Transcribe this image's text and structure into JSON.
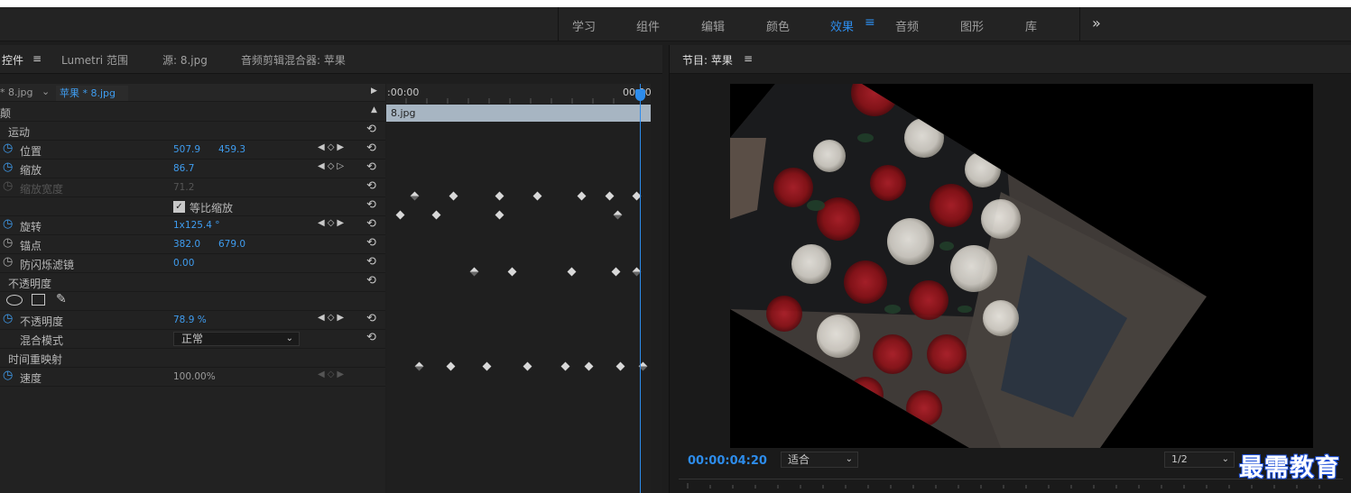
{
  "workspaces": {
    "items": [
      "学习",
      "组件",
      "编辑",
      "颜色",
      "效果",
      "音频",
      "图形",
      "库"
    ],
    "active": "效果",
    "more": "»"
  },
  "effect_controls": {
    "tabs": {
      "effect_controls": "控件",
      "lumetri": "Lumetri 范围",
      "source": "源: 8.jpg",
      "mixer": "音频剪辑混合器: 苹果"
    },
    "menu_glyph": "≡",
    "clip": {
      "source": "* 8.jpg",
      "sequence": "苹果 * 8.jpg"
    },
    "video_label": "颠",
    "motion": "运动",
    "position": {
      "label": "位置",
      "x": "507.9",
      "y": "459.3"
    },
    "scale": {
      "label": "缩放",
      "value": "86.7"
    },
    "scale_width": {
      "label": "缩放宽度",
      "value": "71.2"
    },
    "uniform_scale": "等比缩放",
    "rotation": {
      "label": "旋转",
      "value": "1x125.4 °"
    },
    "anchor": {
      "label": "锚点",
      "x": "382.0",
      "y": "679.0"
    },
    "antiflicker": {
      "label": "防闪烁滤镜",
      "value": "0.00"
    },
    "opacity_group": "不透明度",
    "opacity": {
      "label": "不透明度",
      "value": "78.9 %"
    },
    "blend": {
      "label": "混合模式",
      "value": "正常"
    },
    "time_remap": "时间重映射",
    "speed": {
      "label": "速度",
      "value": "100.00%"
    }
  },
  "timeline": {
    "start": ":00:00",
    "end": "00:00",
    "clip_name": "8.jpg"
  },
  "program": {
    "title": "节目: 苹果",
    "menu_glyph": "≡",
    "timecode": "00:00:04:20",
    "fit": "适合",
    "resolution": "1/2"
  },
  "watermark": "最需教育",
  "colors": {
    "accent": "#2d8ceb",
    "clip_bar": "#a7b5c2"
  }
}
